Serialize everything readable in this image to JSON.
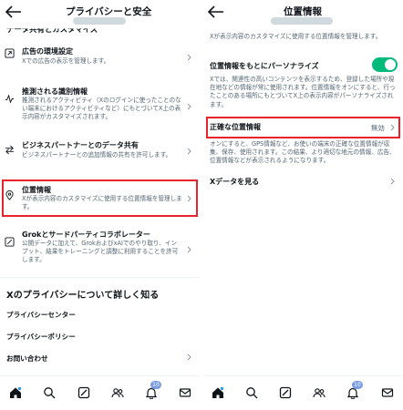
{
  "left": {
    "title": "プライバシーと安全",
    "partial_heading": "データ共有とカスタマイズ",
    "items": [
      {
        "title": "広告の環境設定",
        "desc": "Xでの広告の表示を管理します。",
        "icon": "ads-icon"
      },
      {
        "title": "推測される識別情報",
        "desc": "推測されるアクティビティ（Xのログインに使ったことのない端末におけるアクティビティなど）にもとづいてX上の表示内容がカスタマイズされます。",
        "icon": "activity-icon"
      },
      {
        "title": "ビジネスパートナーとのデータ共有",
        "desc": "ビジネスパートナーとの追加情報の共有を許可します。",
        "icon": "share-arrows-icon"
      },
      {
        "title": "位置情報",
        "desc": "Xが表示内容のカスタマイズに使用する位置情報を管理します。",
        "icon": "location-pin-icon"
      },
      {
        "title": "Grokとサードパーティコラボレーター",
        "desc": "公開データに加えて、GrokおよびxAIでのやり取り、インプット、結果をトレーニングと調整に利用することを許可します。",
        "icon": "grok-icon"
      }
    ],
    "section_title": "Xのプライバシーについて詳しく知る",
    "links": [
      "プライバシーセンター",
      "プライバシーポリシー",
      "お問い合わせ"
    ]
  },
  "right": {
    "title": "位置情報",
    "intro": "Xが表示内容のカスタマイズに使用する位置情報を管理します。",
    "personalize_title": "位置情報をもとにパーソナライズ",
    "personalize_desc": "Xでは、関連性の高いコンテンツを表示するため、登録した場所や現在地などの情報が常に使用されます。位置情報をオンにすると、行ったことのある場所にもとづいてX上の表示内容がパーソナライズされます。",
    "precise_title": "正確な位置情報",
    "precise_value": "無効",
    "precise_desc": "オンにすると、GPS情報など、お使いの端末の正確な位置情報が収集、保存、使用されます。この結果、より適切な地元の情報、広告、位置情報などが表示されるようになります。",
    "x_data": "Xデータを見る"
  },
  "nav": {
    "badge_left": "10",
    "badge_right": "10",
    "icons": [
      "home-icon",
      "search-icon",
      "grok-icon",
      "communities-icon",
      "notifications-icon",
      "messages-icon"
    ]
  },
  "colors": {
    "highlight": "#e8232d",
    "toggle_on": "#00ba7c",
    "badge": "#7a9ddf"
  }
}
